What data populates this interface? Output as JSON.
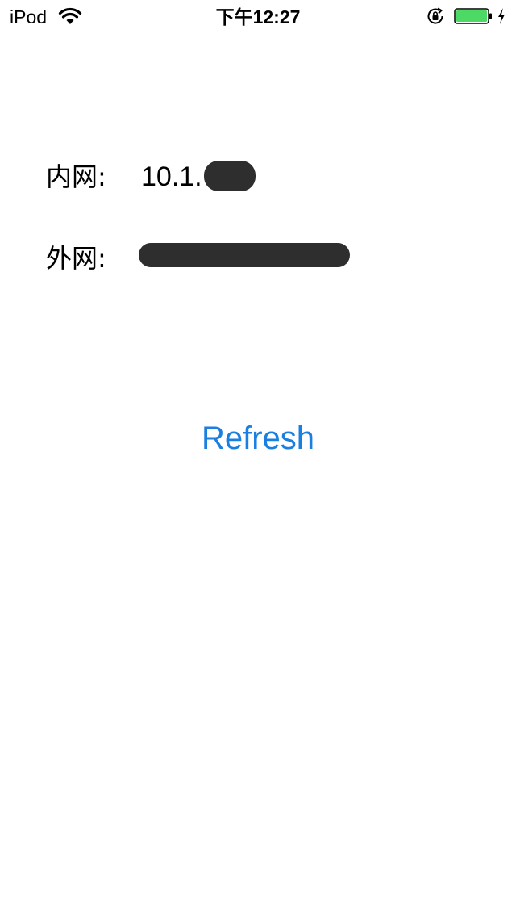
{
  "status_bar": {
    "carrier": "iPod",
    "time": "下午12:27",
    "battery_color": "#4cd964"
  },
  "info": {
    "intranet_label": "内网:",
    "intranet_value": "10.1.",
    "extranet_label": "外网:"
  },
  "refresh_label": "Refresh",
  "colors": {
    "accent": "#1a7fe0",
    "redaction": "#2e2e2e"
  }
}
